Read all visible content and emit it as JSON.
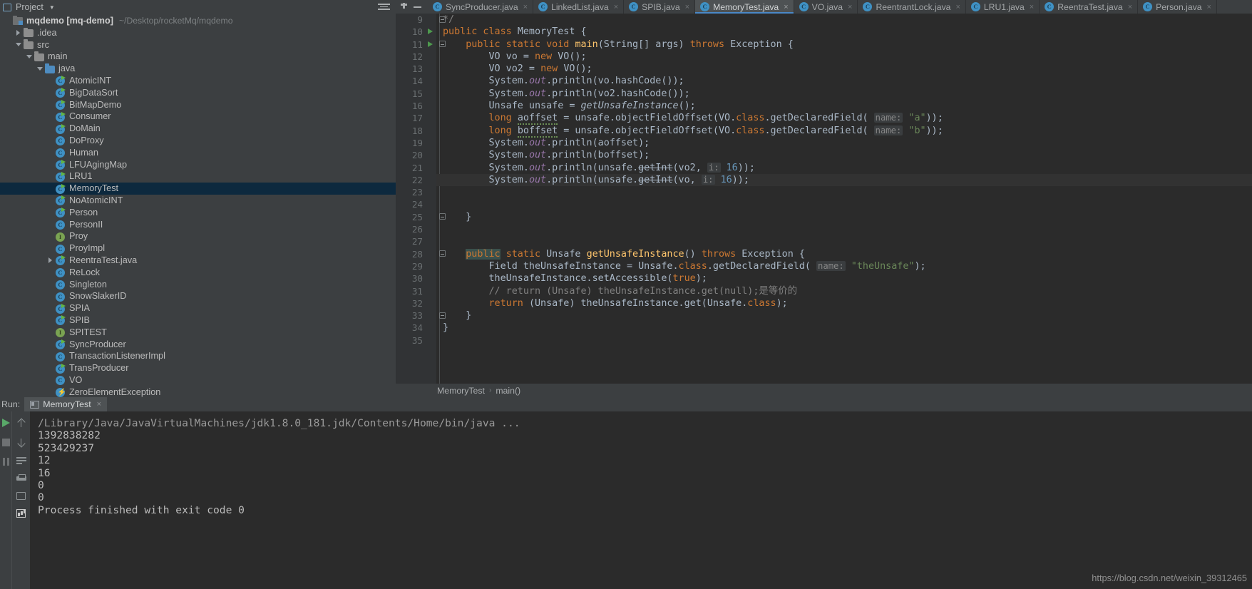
{
  "project_panel": {
    "title": "Project",
    "icons": {
      "panel": "project-icon",
      "caret": "chevron-down-icon",
      "collapse": "collapse-all-icon"
    },
    "root": {
      "label": "mqdemo [mq-demo]",
      "path": "~/Desktop/rocketMq/mqdemo"
    },
    "tree": [
      {
        "label": ".idea",
        "icon": "folder-icon",
        "indent": 1,
        "twisty": "collapsed"
      },
      {
        "label": "src",
        "icon": "folder-icon",
        "indent": 1,
        "twisty": "expanded"
      },
      {
        "label": "main",
        "icon": "folder-icon",
        "indent": 2,
        "twisty": "expanded"
      },
      {
        "label": "java",
        "icon": "source-folder-icon",
        "indent": 3,
        "twisty": "expanded"
      },
      {
        "label": "AtomicINT",
        "icon": "java-class-runnable-icon",
        "indent": 4,
        "twisty": "none"
      },
      {
        "label": "BigDataSort",
        "icon": "java-class-runnable-icon",
        "indent": 4,
        "twisty": "none"
      },
      {
        "label": "BitMapDemo",
        "icon": "java-class-runnable-icon",
        "indent": 4,
        "twisty": "none"
      },
      {
        "label": "Consumer",
        "icon": "java-class-runnable-icon",
        "indent": 4,
        "twisty": "none"
      },
      {
        "label": "DoMain",
        "icon": "java-class-runnable-icon",
        "indent": 4,
        "twisty": "none"
      },
      {
        "label": "DoProxy",
        "icon": "java-class-icon",
        "indent": 4,
        "twisty": "none"
      },
      {
        "label": "Human",
        "icon": "java-class-icon",
        "indent": 4,
        "twisty": "none"
      },
      {
        "label": "LFUAgingMap",
        "icon": "java-class-runnable-icon",
        "indent": 4,
        "twisty": "none"
      },
      {
        "label": "LRU1",
        "icon": "java-class-runnable-icon",
        "indent": 4,
        "twisty": "none"
      },
      {
        "label": "MemoryTest",
        "icon": "java-class-runnable-icon",
        "indent": 4,
        "twisty": "none",
        "selected": true
      },
      {
        "label": "NoAtomicINT",
        "icon": "java-class-runnable-icon",
        "indent": 4,
        "twisty": "none"
      },
      {
        "label": "Person",
        "icon": "java-class-runnable-icon",
        "indent": 4,
        "twisty": "none"
      },
      {
        "label": "PersonII",
        "icon": "java-class-icon",
        "indent": 4,
        "twisty": "none"
      },
      {
        "label": "Proy",
        "icon": "java-interface-icon",
        "indent": 4,
        "twisty": "none"
      },
      {
        "label": "ProyImpl",
        "icon": "java-class-icon",
        "indent": 4,
        "twisty": "none"
      },
      {
        "label": "ReentraTest.java",
        "icon": "java-class-runnable-icon",
        "indent": 4,
        "twisty": "collapsed"
      },
      {
        "label": "ReLock",
        "icon": "java-class-icon",
        "indent": 4,
        "twisty": "none"
      },
      {
        "label": "Singleton",
        "icon": "java-class-icon",
        "indent": 4,
        "twisty": "none"
      },
      {
        "label": "SnowSlakerID",
        "icon": "java-class-icon",
        "indent": 4,
        "twisty": "none"
      },
      {
        "label": "SPIA",
        "icon": "java-class-runnable-icon",
        "indent": 4,
        "twisty": "none"
      },
      {
        "label": "SPIB",
        "icon": "java-class-runnable-icon",
        "indent": 4,
        "twisty": "none"
      },
      {
        "label": "SPITEST",
        "icon": "java-interface-icon",
        "indent": 4,
        "twisty": "none"
      },
      {
        "label": "SyncProducer",
        "icon": "java-class-runnable-icon",
        "indent": 4,
        "twisty": "none"
      },
      {
        "label": "TransactionListenerImpl",
        "icon": "java-class-icon",
        "indent": 4,
        "twisty": "none"
      },
      {
        "label": "TransProducer",
        "icon": "java-class-runnable-icon",
        "indent": 4,
        "twisty": "none"
      },
      {
        "label": "VO",
        "icon": "java-class-icon",
        "indent": 4,
        "twisty": "none"
      },
      {
        "label": "ZeroElementException",
        "icon": "java-exception-icon",
        "indent": 4,
        "twisty": "none"
      }
    ]
  },
  "editor": {
    "tools": {
      "pin": "pin-tab-icon",
      "minimize": "hide-icon"
    },
    "tabs": [
      {
        "label": "SyncProducer.java",
        "icon": "java-class-icon",
        "active": false
      },
      {
        "label": "LinkedList.java",
        "icon": "java-class-readonly-icon",
        "active": false
      },
      {
        "label": "SPIB.java",
        "icon": "java-class-icon",
        "active": false
      },
      {
        "label": "MemoryTest.java",
        "icon": "java-class-icon",
        "active": true
      },
      {
        "label": "VO.java",
        "icon": "java-class-icon",
        "active": false
      },
      {
        "label": "ReentrantLock.java",
        "icon": "java-class-readonly-icon",
        "active": false
      },
      {
        "label": "LRU1.java",
        "icon": "java-class-icon",
        "active": false
      },
      {
        "label": "ReentraTest.java",
        "icon": "java-class-icon",
        "active": false
      },
      {
        "label": "Person.java",
        "icon": "java-class-icon",
        "active": false
      }
    ],
    "close_glyph": "×",
    "first_line_number": 9,
    "last_line_number": 35,
    "breadcrumbs": [
      "MemoryTest",
      "main()"
    ],
    "breadcrumb_separator": "›",
    "code_lines": [
      {
        "n": 9,
        "marker": "fold",
        "html": "<span class=\"cmt\">*/</span>"
      },
      {
        "n": 10,
        "marker": "run",
        "html": "<span class=\"kw\">public class</span> <span class=\"plain\">MemoryTest {</span>"
      },
      {
        "n": 11,
        "marker": "run-fold",
        "html": "    <span class=\"kw\">public static void</span> <span class=\"mth\">main</span><span class=\"plain\">(String[] args) </span><span class=\"kw\">throws</span> <span class=\"plain\">Exception {</span>"
      },
      {
        "n": 12,
        "marker": "",
        "html": "        <span class=\"plain\">VO vo = </span><span class=\"kw\">new </span><span class=\"plain\">VO();</span>"
      },
      {
        "n": 13,
        "marker": "",
        "html": "        <span class=\"plain\">VO vo2 = </span><span class=\"kw\">new </span><span class=\"plain\">VO();</span>"
      },
      {
        "n": 14,
        "marker": "",
        "html": "        <span class=\"plain\">System.</span><span class=\"fld\">out</span><span class=\"plain\">.println(vo.hashCode());</span>"
      },
      {
        "n": 15,
        "marker": "",
        "html": "        <span class=\"plain\">System.</span><span class=\"fld\">out</span><span class=\"plain\">.println(vo2.hashCode());</span>"
      },
      {
        "n": 16,
        "marker": "",
        "html": "        <span class=\"plain\">Unsafe unsafe = </span><span class=\"mthi\">getUnsafeInstance</span><span class=\"plain\">();</span>"
      },
      {
        "n": 17,
        "marker": "",
        "html": "        <span class=\"kw\">long </span><span class=\"plain sq\">aoffset</span><span class=\"plain\"> = unsafe.objectFieldOffset(VO.</span><span class=\"kw\">class</span><span class=\"plain\">.getDeclaredField(</span> <span class=\"hint\">name:</span> <span class=\"str\">\"a\"</span><span class=\"plain\">));</span>"
      },
      {
        "n": 18,
        "marker": "",
        "html": "        <span class=\"kw\">long </span><span class=\"plain sq\">boffset</span><span class=\"plain\"> = unsafe.objectFieldOffset(VO.</span><span class=\"kw\">class</span><span class=\"plain\">.getDeclaredField(</span> <span class=\"hint\">name:</span> <span class=\"str\">\"b\"</span><span class=\"plain\">));</span>"
      },
      {
        "n": 19,
        "marker": "",
        "html": "        <span class=\"plain\">System.</span><span class=\"fld\">out</span><span class=\"plain\">.println(aoffset);</span>"
      },
      {
        "n": 20,
        "marker": "",
        "html": "        <span class=\"plain\">System.</span><span class=\"fld\">out</span><span class=\"plain\">.println(boffset);</span>"
      },
      {
        "n": 21,
        "marker": "",
        "html": "        <span class=\"plain\">System.</span><span class=\"fld\">out</span><span class=\"plain\">.println(unsafe.</span><span class=\"plain strike\">getInt</span><span class=\"plain\">(vo2,</span> <span class=\"hint\">i:</span> <span class=\"num\">16</span><span class=\"plain\">));</span>"
      },
      {
        "n": 22,
        "marker": "",
        "current": true,
        "html": "        <span class=\"plain\">System.</span><span class=\"fld\">out</span><span class=\"plain\">.println(unsafe.</span><span class=\"plain strike\">getInt</span><span class=\"plain\">(vo,</span> <span class=\"hint\">i:</span> <span class=\"num\">16</span><span class=\"plain\">));</span>"
      },
      {
        "n": 23,
        "marker": "",
        "html": ""
      },
      {
        "n": 24,
        "marker": "",
        "html": ""
      },
      {
        "n": 25,
        "marker": "fold",
        "html": "    <span class=\"plain\">}</span>"
      },
      {
        "n": 26,
        "marker": "",
        "html": ""
      },
      {
        "n": 27,
        "marker": "",
        "html": ""
      },
      {
        "n": 28,
        "marker": "fold",
        "html": "    <span class=\"kw hl\">public</span> <span class=\"kw\">static</span> <span class=\"plain\">Unsafe </span><span class=\"mth\">getUnsafeInstance</span><span class=\"plain\">() </span><span class=\"kw\">throws</span> <span class=\"plain\">Exception {</span>"
      },
      {
        "n": 29,
        "marker": "",
        "html": "        <span class=\"plain\">Field theUnsafeInstance = Unsafe.</span><span class=\"kw\">class</span><span class=\"plain\">.getDeclaredField(</span> <span class=\"hint\">name:</span> <span class=\"str\">\"theUnsafe\"</span><span class=\"plain\">);</span>"
      },
      {
        "n": 30,
        "marker": "",
        "html": "        <span class=\"plain\">theUnsafeInstance.setAccessible(</span><span class=\"kw\">true</span><span class=\"plain\">);</span>"
      },
      {
        "n": 31,
        "marker": "",
        "html": "        <span class=\"cmt\">// return (Unsafe) theUnsafeInstance.get(null);是等价的</span>"
      },
      {
        "n": 32,
        "marker": "",
        "html": "        <span class=\"kw\">return </span><span class=\"plain\">(Unsafe) theUnsafeInstance.get(Unsafe.</span><span class=\"kw\">class</span><span class=\"plain\">);</span>"
      },
      {
        "n": 33,
        "marker": "fold",
        "html": "    <span class=\"plain\">}</span>"
      },
      {
        "n": 34,
        "marker": "",
        "html": "<span class=\"plain\">}</span>"
      },
      {
        "n": 35,
        "marker": "",
        "html": ""
      }
    ]
  },
  "run_panel": {
    "label": "Run:",
    "tab_label": "MemoryTest",
    "tab_close_glyph": "×",
    "toolbar_icons": [
      "rerun-icon",
      "stop-icon",
      "pause-icon"
    ],
    "toolbar2_icons": [
      "up-arrow-icon",
      "down-arrow-icon",
      "soft-wrap-icon",
      "print-icon",
      "scroll-to-end-icon",
      "clear-all-icon"
    ],
    "console_lines": [
      {
        "text": "/Library/Java/JavaVirtualMachines/jdk1.8.0_181.jdk/Contents/Home/bin/java ...",
        "dim": true
      },
      {
        "text": "1392838282",
        "dim": false
      },
      {
        "text": "523429237",
        "dim": false
      },
      {
        "text": "12",
        "dim": false
      },
      {
        "text": "16",
        "dim": false
      },
      {
        "text": "0",
        "dim": false
      },
      {
        "text": "0",
        "dim": false
      },
      {
        "text": "",
        "dim": false
      },
      {
        "text": "Process finished with exit code 0",
        "dim": false
      }
    ],
    "watermark": "https://blog.csdn.net/weixin_39312465"
  },
  "colors": {
    "accent_blue": "#4a88c7",
    "selection": "#0d293e",
    "editor_bg": "#2b2b2b",
    "panel_bg": "#3c3f41",
    "keyword": "#cc7832",
    "string": "#6a8759",
    "number": "#6897bb",
    "comment": "#808080",
    "method": "#ffc66d",
    "field": "#9876aa",
    "run_green": "#59a869"
  }
}
